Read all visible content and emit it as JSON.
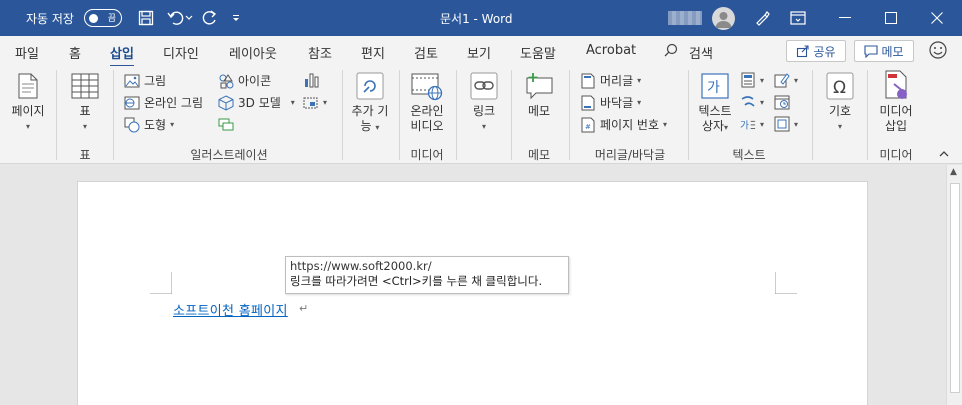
{
  "titlebar": {
    "autosave_label": "자동 저장",
    "autosave_state": "끔",
    "doc_title": "문서1  -  Word",
    "bg": "#2b579a"
  },
  "tabs": [
    "파일",
    "홈",
    "삽입",
    "디자인",
    "레이아웃",
    "참조",
    "편지",
    "검토",
    "보기",
    "도움말",
    "Acrobat"
  ],
  "active_tab": "삽입",
  "search_label": "검색",
  "share_label": "공유",
  "memo_label": "메모",
  "ribbon": {
    "page": "페이지",
    "table": "표",
    "table_group": "표",
    "pictures": "그림",
    "online_pictures": "온라인 그림",
    "shapes": "도형",
    "icons": "아이콘",
    "models3d": "3D 모델",
    "illustrations_group": "일러스트레이션",
    "addins_line1": "추가 기",
    "addins_line2": "능",
    "online_video_line1": "온라인",
    "online_video_line2": "비디오",
    "media_group": "미디어",
    "link": "링크",
    "memo": "메모",
    "memo_group": "메모",
    "header": "머리글",
    "footer": "바닥글",
    "page_number": "페이지 번호",
    "header_footer_group": "머리글/바닥글",
    "textbox_line1": "텍스트",
    "textbox_line2": "상자",
    "text_group": "텍스트",
    "symbol": "기호",
    "media_insert_line1": "미디어",
    "media_insert_line2": "삽입",
    "media_group2": "미디어"
  },
  "document": {
    "tooltip_url": "https://www.soft2000.kr/",
    "tooltip_hint": "링크를 따라가려면 <Ctrl>키를 누른 채 클릭합니다.",
    "link_text": "소프트이천 홈페이지",
    "para_mark": "↵"
  }
}
